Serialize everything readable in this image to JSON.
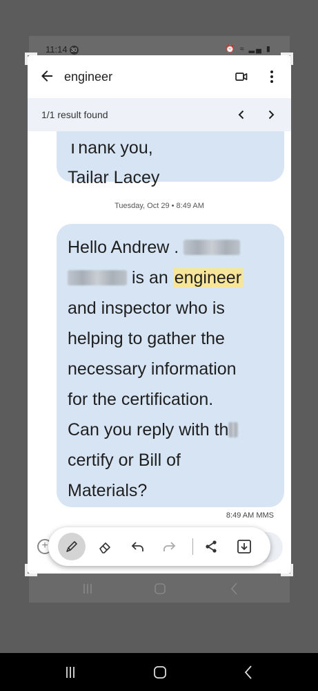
{
  "status_bar": {
    "time": "11:14",
    "notification_badge": "30"
  },
  "app_bar": {
    "search_query": "engineer",
    "icons": [
      "back-arrow-icon",
      "video-call-icon",
      "more-vert-icon"
    ]
  },
  "search_results": {
    "summary": "1/1 result found",
    "icons": [
      "chevron-left-icon",
      "chevron-right-icon"
    ]
  },
  "conversation": {
    "previous_message_lines": [
      "Thank you,",
      "Tailar Lacey"
    ],
    "date_separator": "Tuesday, Oct 29 • 8:49 AM",
    "message": {
      "greeting": "Hello Andrew .",
      "after_redaction": "is an",
      "highlight": "engineer",
      "line_3": "and inspector who is",
      "line_4": "helping to gather the",
      "line_5": "necessary information",
      "line_6": "for the certification.",
      "line_7": "Can you reply with th",
      "line_8": "certify or Bill of",
      "line_9": "Materials?"
    },
    "timestamp": "8:49 AM MMS"
  },
  "edit_toolbar": {
    "tools": [
      "pen-icon",
      "eraser-icon",
      "undo-icon",
      "redo-icon",
      "share-icon",
      "save-icon"
    ],
    "active_tool": "pen-icon",
    "active_color": "#d4d4d4"
  },
  "colors": {
    "bubble": "#d6e4f3",
    "highlight": "#f7e59a",
    "result_bar": "#eef1f8"
  }
}
